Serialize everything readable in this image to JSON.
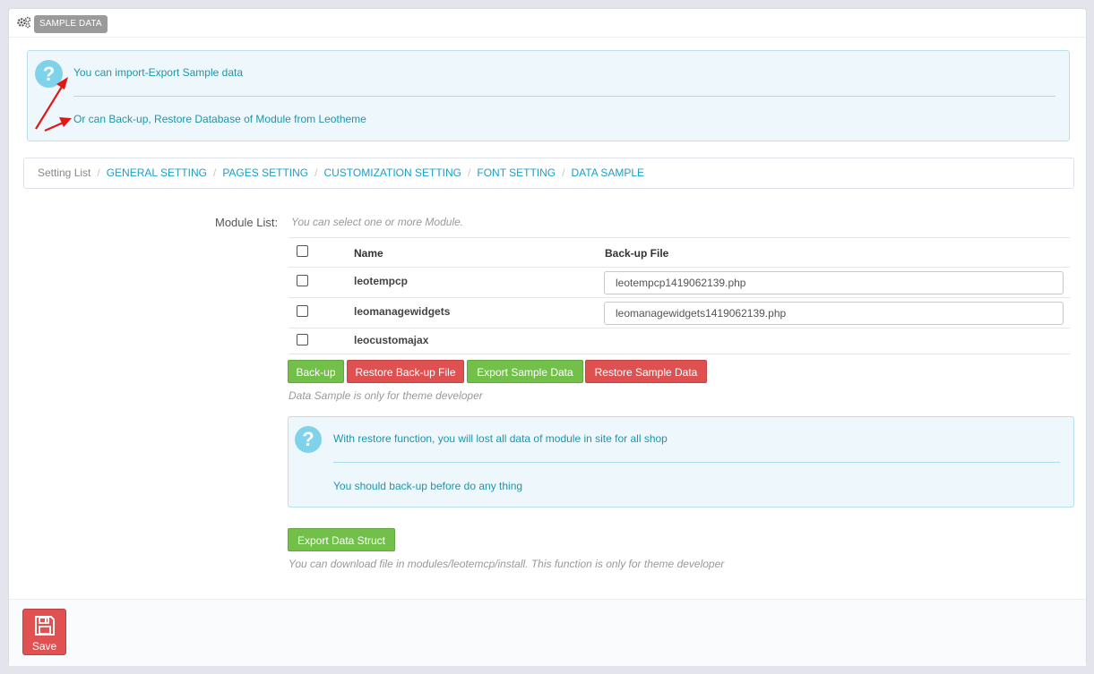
{
  "panel": {
    "header_label": "SAMPLE DATA",
    "header_icon": "gears-icon"
  },
  "top_alert": {
    "line1": "You can import-Export Sample data",
    "line2": "Or can Back-up, Restore Database of Module from Leotheme",
    "icon": "question-icon"
  },
  "breadcrumb": {
    "items": [
      "Setting List",
      "GENERAL SETTING",
      "PAGES SETTING",
      "CUSTOMIZATION SETTING",
      "FONT SETTING",
      "DATA SAMPLE"
    ],
    "separator": "/"
  },
  "module_list": {
    "label": "Module List:",
    "hint": "You can select one or more Module.",
    "columns": [
      "Name",
      "Back-up File"
    ],
    "rows": [
      {
        "name": "leotempcp",
        "backup_file": "leotempcp1419062139.php"
      },
      {
        "name": "leomanagewidgets",
        "backup_file": "leomanagewidgets1419062139.php"
      },
      {
        "name": "leocustomajax",
        "backup_file": ""
      }
    ]
  },
  "actions": {
    "backup": "Back-up",
    "restore_backup": "Restore Back-up File",
    "export_sample": "Export Sample Data",
    "restore_sample": "Restore Sample Data",
    "note": "Data Sample is only for theme developer"
  },
  "warning_alert": {
    "line1": "With restore function, you will lost all data of module in site for all shop",
    "line2": "You should back-up before do any thing",
    "icon": "question-icon"
  },
  "export_struct": {
    "button": "Export Data Struct",
    "note": "You can download file in modules/leotemcp/install. This function is only for theme developer"
  },
  "footer": {
    "save": "Save",
    "save_icon": "floppy-disk-icon"
  },
  "colors": {
    "green": "#72c04a",
    "red": "#df5151",
    "link": "#1c9ec8",
    "alert_text": "#1e94ab"
  }
}
